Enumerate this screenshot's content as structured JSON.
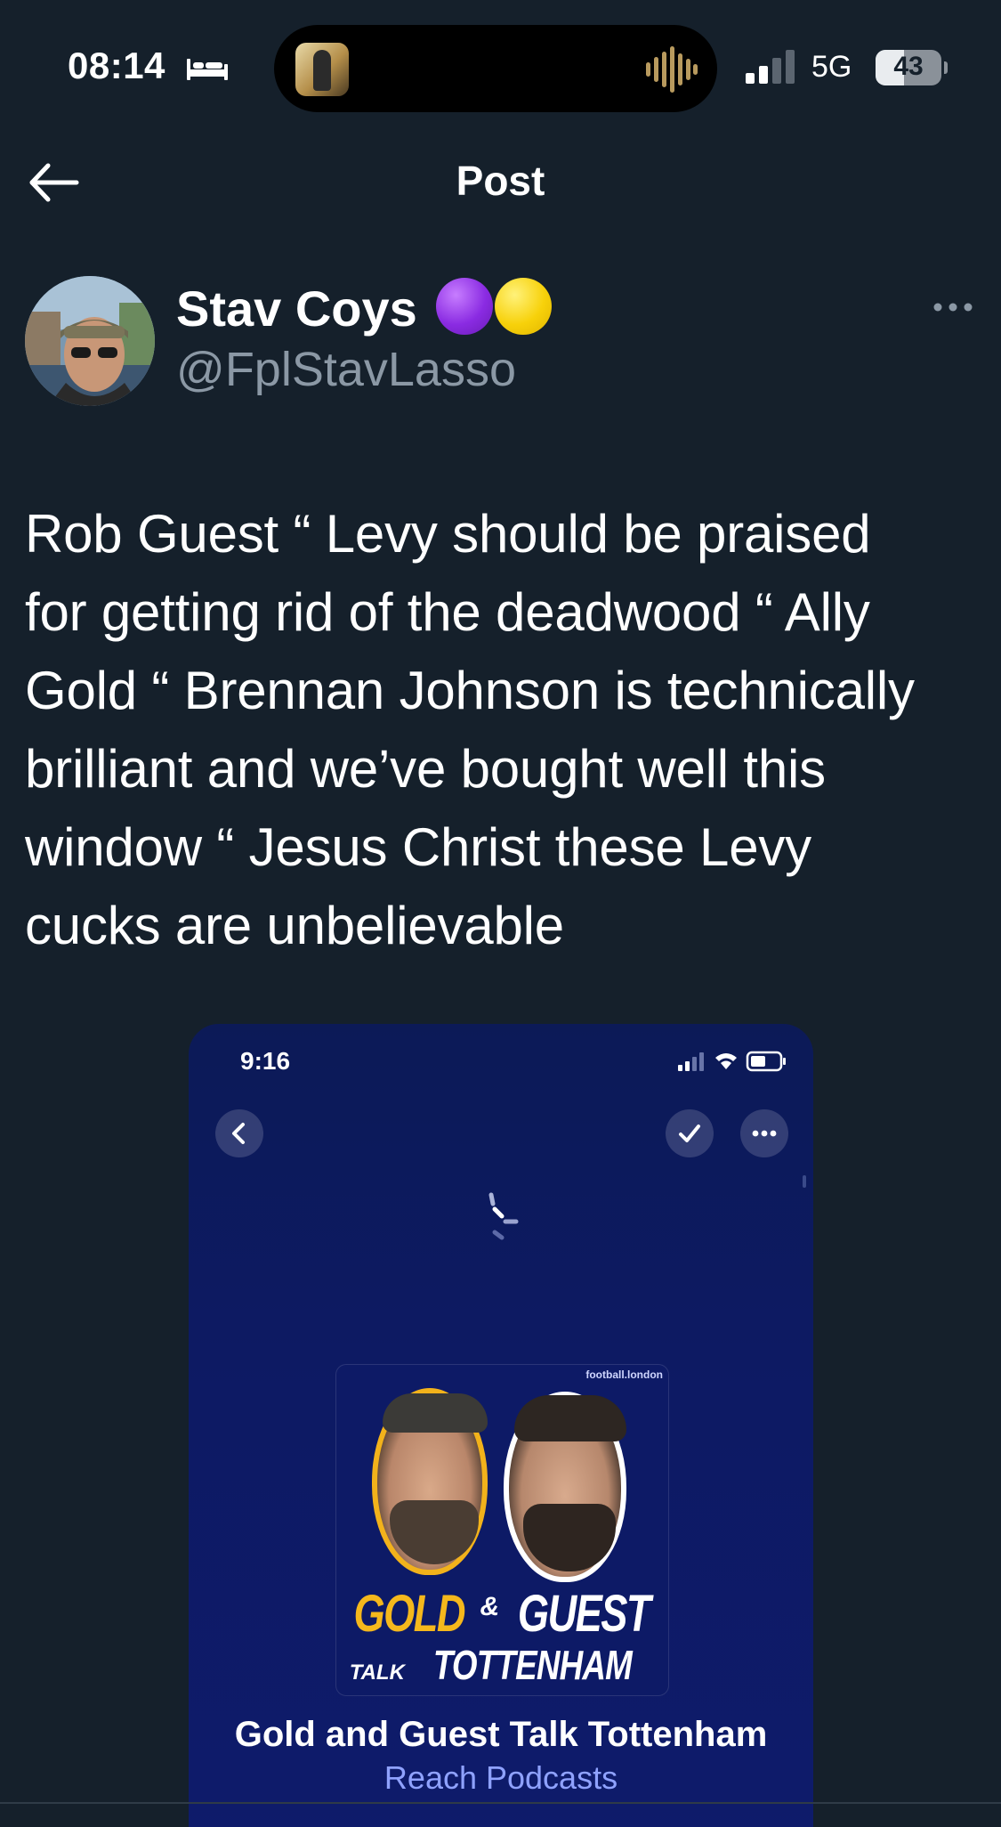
{
  "status_bar": {
    "time": "08:14",
    "network": "5G",
    "battery": "43",
    "battery_level": 0.43
  },
  "header": {
    "title": "Post",
    "back_icon": "arrow-left-icon"
  },
  "post": {
    "author": {
      "display_name": "Stav Coys",
      "handle": "@FplStavLasso",
      "name_emojis": [
        "purple-circle",
        "yellow-circle"
      ]
    },
    "more_icon": "ellipsis-icon",
    "lines": [
      "Rob Guest “ Levy should be praised",
      "for getting rid of the deadwood “ Ally",
      "Gold “ Brennan Johnson is technically",
      "brilliant and we’ve bought well this",
      "window “ Jesus Christ these Levy",
      "cucks are unbelievable"
    ]
  },
  "media": {
    "time": "9:16",
    "cover_brand": "football.london",
    "cover_title_gold": "GOLD",
    "cover_title_amp": "&",
    "cover_title_guest": "GUEST",
    "cover_sub_talk": "TALK",
    "cover_sub_team": "TOTTENHAM",
    "podcast_title": "Gold and Guest Talk Tottenham",
    "podcast_publisher": "Reach Podcasts"
  },
  "colors": {
    "background": "#15202b",
    "secondary_text": "#8b98a5",
    "media_background": "#0d1a63",
    "publisher_link": "#8fa2ff",
    "cover_gold": "#f5b81c"
  }
}
